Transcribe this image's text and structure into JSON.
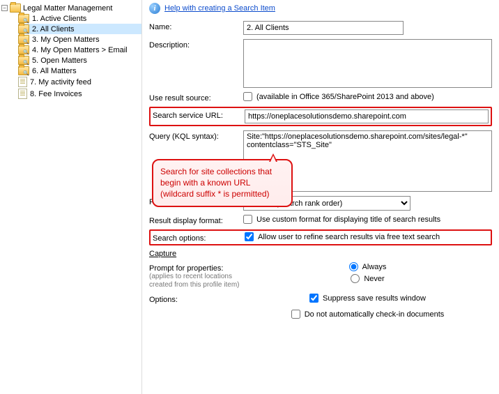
{
  "tree": {
    "root": "Legal Matter Management",
    "items": [
      "1. Active Clients",
      "2. All Clients",
      "3. My Open Matters",
      "4. My Open Matters > Email",
      "5. Open Matters",
      "6. All Matters",
      "7. My activity feed",
      "8. Fee Invoices"
    ],
    "selected_index": 1
  },
  "help": {
    "link": "Help with creating a Search Item"
  },
  "form": {
    "name_label": "Name:",
    "name_value": "2. All Clients",
    "description_label": "Description:",
    "description_value": "",
    "use_result_source_label": "Use result source:",
    "use_result_source_checked": false,
    "use_result_source_note": "(available in Office 365/SharePoint 2013 and above)",
    "search_url_label": "Search service URL:",
    "search_url_value": "https://oneplacesolutionsdemo.sharepoint.com",
    "query_label": "Query (KQL syntax):",
    "query_value": "Site:\"https://oneplacesolutionsdemo.sharepoint.com/sites/legal-*\" contentclass=\"STS_Site\"",
    "sort_label": "Result sort order:",
    "sort_value": "Default (Search rank order)",
    "display_format_label": "Result display format:",
    "display_format_checked": false,
    "display_format_text": "Use custom format for displaying title of search results",
    "search_options_label": "Search options:",
    "search_options_checked": true,
    "search_options_text": "Allow user to refine search results via free text search",
    "capture_heading": "Capture",
    "prompt_label": "Prompt for properties:",
    "prompt_sub": "(applies to recent locations created from this profile item)",
    "prompt_always": "Always",
    "prompt_never": "Never",
    "prompt_value": "always",
    "options_label": "Options:",
    "opt_suppress_checked": true,
    "opt_suppress_text": "Suppress save results window",
    "opt_nocheckin_checked": false,
    "opt_nocheckin_text": "Do not automatically check-in documents"
  },
  "callout": {
    "text": "Search for site collections that begin with a known URL (wildcard suffix * is permitted)"
  }
}
